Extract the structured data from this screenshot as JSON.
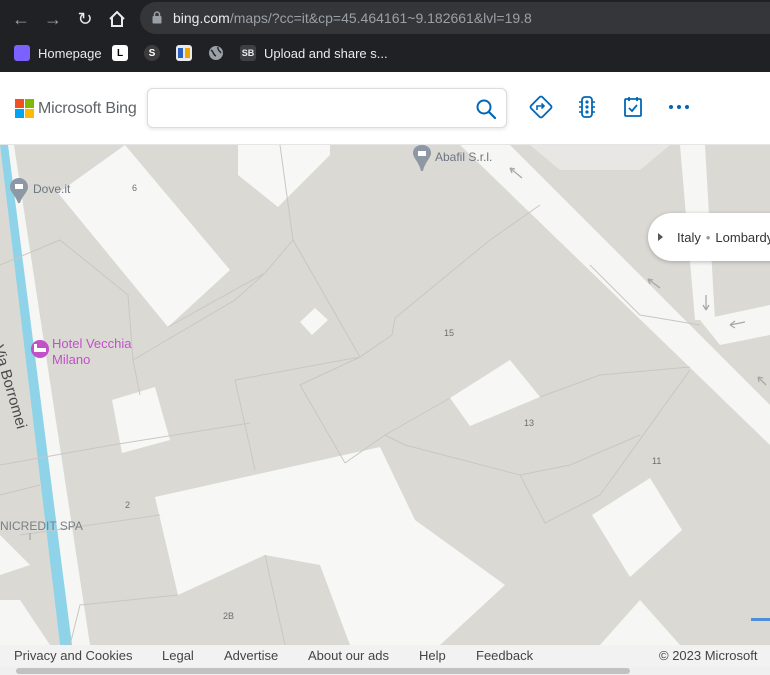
{
  "browser": {
    "url_host": "bing.com",
    "url_path": "/maps/?cc=it&cp=45.464161~9.182661&lvl=19.8",
    "bookmarks": [
      {
        "label": "Homepage",
        "icon": "homepage-icon"
      },
      {
        "label": "",
        "icon": "l-icon"
      },
      {
        "label": "",
        "icon": "s-icon"
      },
      {
        "label": "",
        "icon": "bookmark-icon"
      },
      {
        "label": "",
        "icon": "globe-icon"
      },
      {
        "label": "Upload and share s...",
        "icon": "sb-icon"
      }
    ],
    "bookmark_glyphs": {
      "l": "L",
      "s": "S",
      "sb": "SB"
    }
  },
  "header": {
    "logo_text": "Microsoft Bing",
    "search": {
      "value": "",
      "placeholder": ""
    },
    "logo_colors": [
      "#f25022",
      "#7fba00",
      "#00a4ef",
      "#ffb900"
    ],
    "accent": "#0078d4"
  },
  "map": {
    "numbers": {
      "n6": "6",
      "n15": "15",
      "n13": "13",
      "n11": "11",
      "n2": "2",
      "n2b": "2B"
    },
    "pois": {
      "abafil": "Abafil S.r.l.",
      "dove": "Dove.it",
      "hotel_line1": "Hotel Vecchia",
      "hotel_line2": "Milano",
      "unicredit": "NICREDIT SPA"
    },
    "street": "Via Borromei",
    "breadcrumb": {
      "country": "Italy",
      "region": "Lombardy"
    }
  },
  "footer": {
    "links": [
      "Privacy and Cookies",
      "Legal",
      "Advertise",
      "About our ads",
      "Help",
      "Feedback"
    ],
    "copyright": "© 2023 Microsoft"
  }
}
